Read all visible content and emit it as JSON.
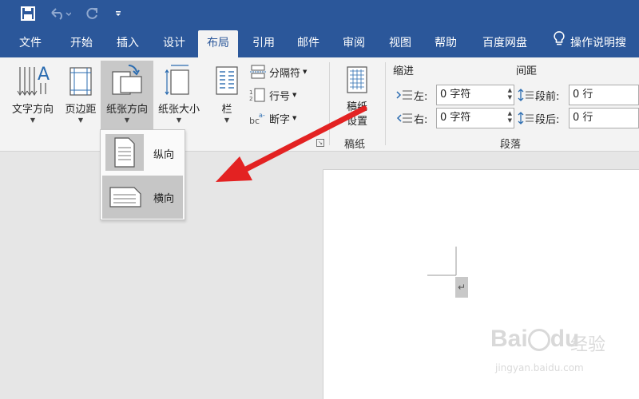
{
  "tabs": [
    "文件",
    "开始",
    "插入",
    "设计",
    "布局",
    "引用",
    "邮件",
    "审阅",
    "视图",
    "帮助",
    "百度网盘"
  ],
  "active_tab": "布局",
  "tell_me": "操作说明搜",
  "ribbon": {
    "text_direction": "文字方向",
    "margins": "页边距",
    "orientation": "纸张方向",
    "size": "纸张大小",
    "columns": "栏",
    "breaks": "分隔符",
    "line_numbers": "行号",
    "hyphenation": "断字",
    "draft_paper": "稿纸\n设置",
    "draft_group": "稿纸",
    "indent_title": "缩进",
    "indent_left_label": "左:",
    "indent_left_value": "0 字符",
    "indent_right_label": "右:",
    "indent_right_value": "0 字符",
    "spacing_title": "间距",
    "spacing_before_label": "段前:",
    "spacing_before_value": "0 行",
    "spacing_after_label": "段后:",
    "spacing_after_value": "0 行",
    "paragraph_group": "段落"
  },
  "dropdown": {
    "portrait": "纵向",
    "landscape": "横向"
  },
  "watermark": {
    "brand": "Bai",
    "brand2": "du",
    "sub": "经验",
    "url": "jingyan.baidu.com"
  },
  "colors": {
    "title_bar": "#2b579a",
    "arrow": "#e32222"
  }
}
